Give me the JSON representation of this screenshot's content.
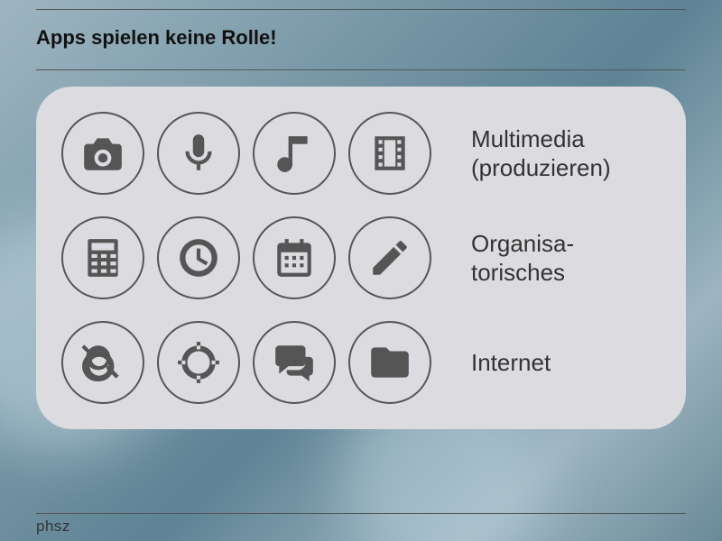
{
  "title": "Apps spielen keine Rolle!",
  "rows": [
    {
      "label": "Multimedia\n(produzieren)"
    },
    {
      "label": "Organisa-\ntorisches"
    },
    {
      "label": "Internet"
    }
  ],
  "footer": {
    "brand": "phsz"
  }
}
